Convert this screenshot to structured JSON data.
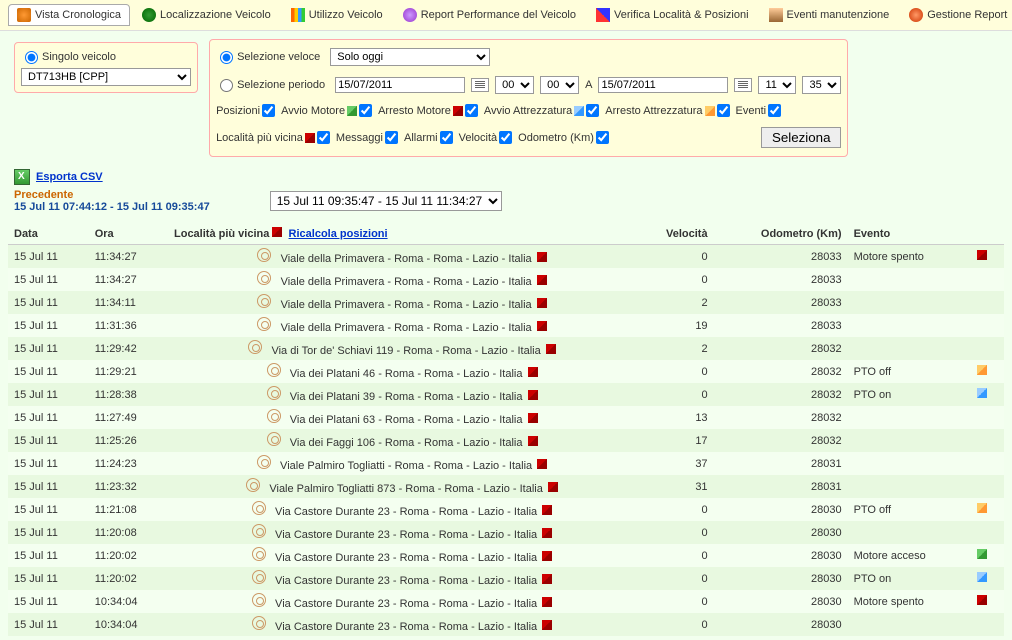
{
  "tabs": {
    "items": [
      {
        "label": "Vista Cronologica",
        "icon": "icon-orange",
        "active": true
      },
      {
        "label": "Localizzazione Veicolo",
        "icon": "icon-globe"
      },
      {
        "label": "Utilizzo Veicolo",
        "icon": "icon-bars"
      },
      {
        "label": "Report Performance del Veicolo",
        "icon": "icon-purple"
      },
      {
        "label": "Verifica Località & Posizioni",
        "icon": "icon-chart"
      },
      {
        "label": "Eventi manutenzione",
        "icon": "icon-maint"
      },
      {
        "label": "Gestione Report",
        "icon": "icon-report"
      }
    ]
  },
  "filters": {
    "single_vehicle_label": "Singolo veicolo",
    "vehicle_value": "DT713HB [CPP]",
    "quick_select_label": "Selezione veloce",
    "quick_select_value": "Solo oggi",
    "period_select_label": "Selezione periodo",
    "date_from": "15/07/2011",
    "hour_from": "00",
    "min_from": "00",
    "period_a": "A",
    "date_to": "15/07/2011",
    "hour_to": "11",
    "min_to": "35",
    "chk_posizioni": "Posizioni",
    "chk_avvio_motore": "Avvio Motore",
    "chk_arresto_motore": "Arresto Motore",
    "chk_avvio_attrezzatura": "Avvio Attrezzatura",
    "chk_arresto_attrezzatura": "Arresto Attrezzatura",
    "chk_eventi": "Eventi",
    "chk_localita": "Località più vicina",
    "chk_messaggi": "Messaggi",
    "chk_allarmi": "Allarmi",
    "chk_velocita": "Velocità",
    "chk_odometro": "Odometro (Km)",
    "btn_seleziona": "Seleziona"
  },
  "export": {
    "label": "Esporta CSV"
  },
  "precedente": {
    "label": "Precedente",
    "range": "15 Jul 11 07:44:12 - 15 Jul 11 09:35:47",
    "current_range": "15 Jul 11 09:35:47 - 15 Jul 11 11:34:27"
  },
  "table": {
    "headers": {
      "data": "Data",
      "ora": "Ora",
      "localita": "Località più vicina",
      "ricalcola": "Ricalcola posizioni",
      "velocita": "Velocità",
      "odometro": "Odometro (Km)",
      "evento": "Evento"
    },
    "rows": [
      {
        "data": "15 Jul 11",
        "ora": "11:34:27",
        "loc": "Viale della Primavera - Roma - Roma - Lazio - Italia",
        "vel": "0",
        "odo": "28033",
        "ev": "Motore spento",
        "flag": "flag-red"
      },
      {
        "data": "15 Jul 11",
        "ora": "11:34:27",
        "loc": "Viale della Primavera - Roma - Roma - Lazio - Italia",
        "vel": "0",
        "odo": "28033",
        "ev": "",
        "flag": ""
      },
      {
        "data": "15 Jul 11",
        "ora": "11:34:11",
        "loc": "Viale della Primavera - Roma - Roma - Lazio - Italia",
        "vel": "2",
        "odo": "28033",
        "ev": "",
        "flag": ""
      },
      {
        "data": "15 Jul 11",
        "ora": "11:31:36",
        "loc": "Viale della Primavera - Roma - Roma - Lazio - Italia",
        "vel": "19",
        "odo": "28033",
        "ev": "",
        "flag": ""
      },
      {
        "data": "15 Jul 11",
        "ora": "11:29:42",
        "loc": "Via di Tor de' Schiavi 119 - Roma - Roma - Lazio - Italia",
        "vel": "2",
        "odo": "28032",
        "ev": "",
        "flag": ""
      },
      {
        "data": "15 Jul 11",
        "ora": "11:29:21",
        "loc": "Via dei Platani 46 - Roma - Roma - Lazio - Italia",
        "vel": "0",
        "odo": "28032",
        "ev": "PTO   off",
        "flag": "flag-orange"
      },
      {
        "data": "15 Jul 11",
        "ora": "11:28:38",
        "loc": "Via dei Platani 39 - Roma - Roma - Lazio - Italia",
        "vel": "0",
        "odo": "28032",
        "ev": "PTO   on",
        "flag": "flag-blue"
      },
      {
        "data": "15 Jul 11",
        "ora": "11:27:49",
        "loc": "Via dei Platani 63 - Roma - Roma - Lazio - Italia",
        "vel": "13",
        "odo": "28032",
        "ev": "",
        "flag": ""
      },
      {
        "data": "15 Jul 11",
        "ora": "11:25:26",
        "loc": "Via dei Faggi 106 - Roma - Roma - Lazio - Italia",
        "vel": "17",
        "odo": "28032",
        "ev": "",
        "flag": ""
      },
      {
        "data": "15 Jul 11",
        "ora": "11:24:23",
        "loc": "Viale Palmiro Togliatti - Roma - Roma - Lazio - Italia",
        "vel": "37",
        "odo": "28031",
        "ev": "",
        "flag": ""
      },
      {
        "data": "15 Jul 11",
        "ora": "11:23:32",
        "loc": "Viale Palmiro Togliatti 873 - Roma - Roma - Lazio - Italia",
        "vel": "31",
        "odo": "28031",
        "ev": "",
        "flag": ""
      },
      {
        "data": "15 Jul 11",
        "ora": "11:21:08",
        "loc": "Via Castore Durante 23 - Roma - Roma - Lazio - Italia",
        "vel": "0",
        "odo": "28030",
        "ev": "PTO   off",
        "flag": "flag-orange"
      },
      {
        "data": "15 Jul 11",
        "ora": "11:20:08",
        "loc": "Via Castore Durante 23 - Roma - Roma - Lazio - Italia",
        "vel": "0",
        "odo": "28030",
        "ev": "",
        "flag": ""
      },
      {
        "data": "15 Jul 11",
        "ora": "11:20:02",
        "loc": "Via Castore Durante 23 - Roma - Roma - Lazio - Italia",
        "vel": "0",
        "odo": "28030",
        "ev": "Motore acceso",
        "flag": "flag-green"
      },
      {
        "data": "15 Jul 11",
        "ora": "11:20:02",
        "loc": "Via Castore Durante 23 - Roma - Roma - Lazio - Italia",
        "vel": "0",
        "odo": "28030",
        "ev": "PTO   on",
        "flag": "flag-blue"
      },
      {
        "data": "15 Jul 11",
        "ora": "10:34:04",
        "loc": "Via Castore Durante 23 - Roma - Roma - Lazio - Italia",
        "vel": "0",
        "odo": "28030",
        "ev": "Motore spento",
        "flag": "flag-red"
      },
      {
        "data": "15 Jul 11",
        "ora": "10:34:04",
        "loc": "Via Castore Durante 23 - Roma - Roma - Lazio - Italia",
        "vel": "0",
        "odo": "28030",
        "ev": "",
        "flag": ""
      }
    ]
  }
}
